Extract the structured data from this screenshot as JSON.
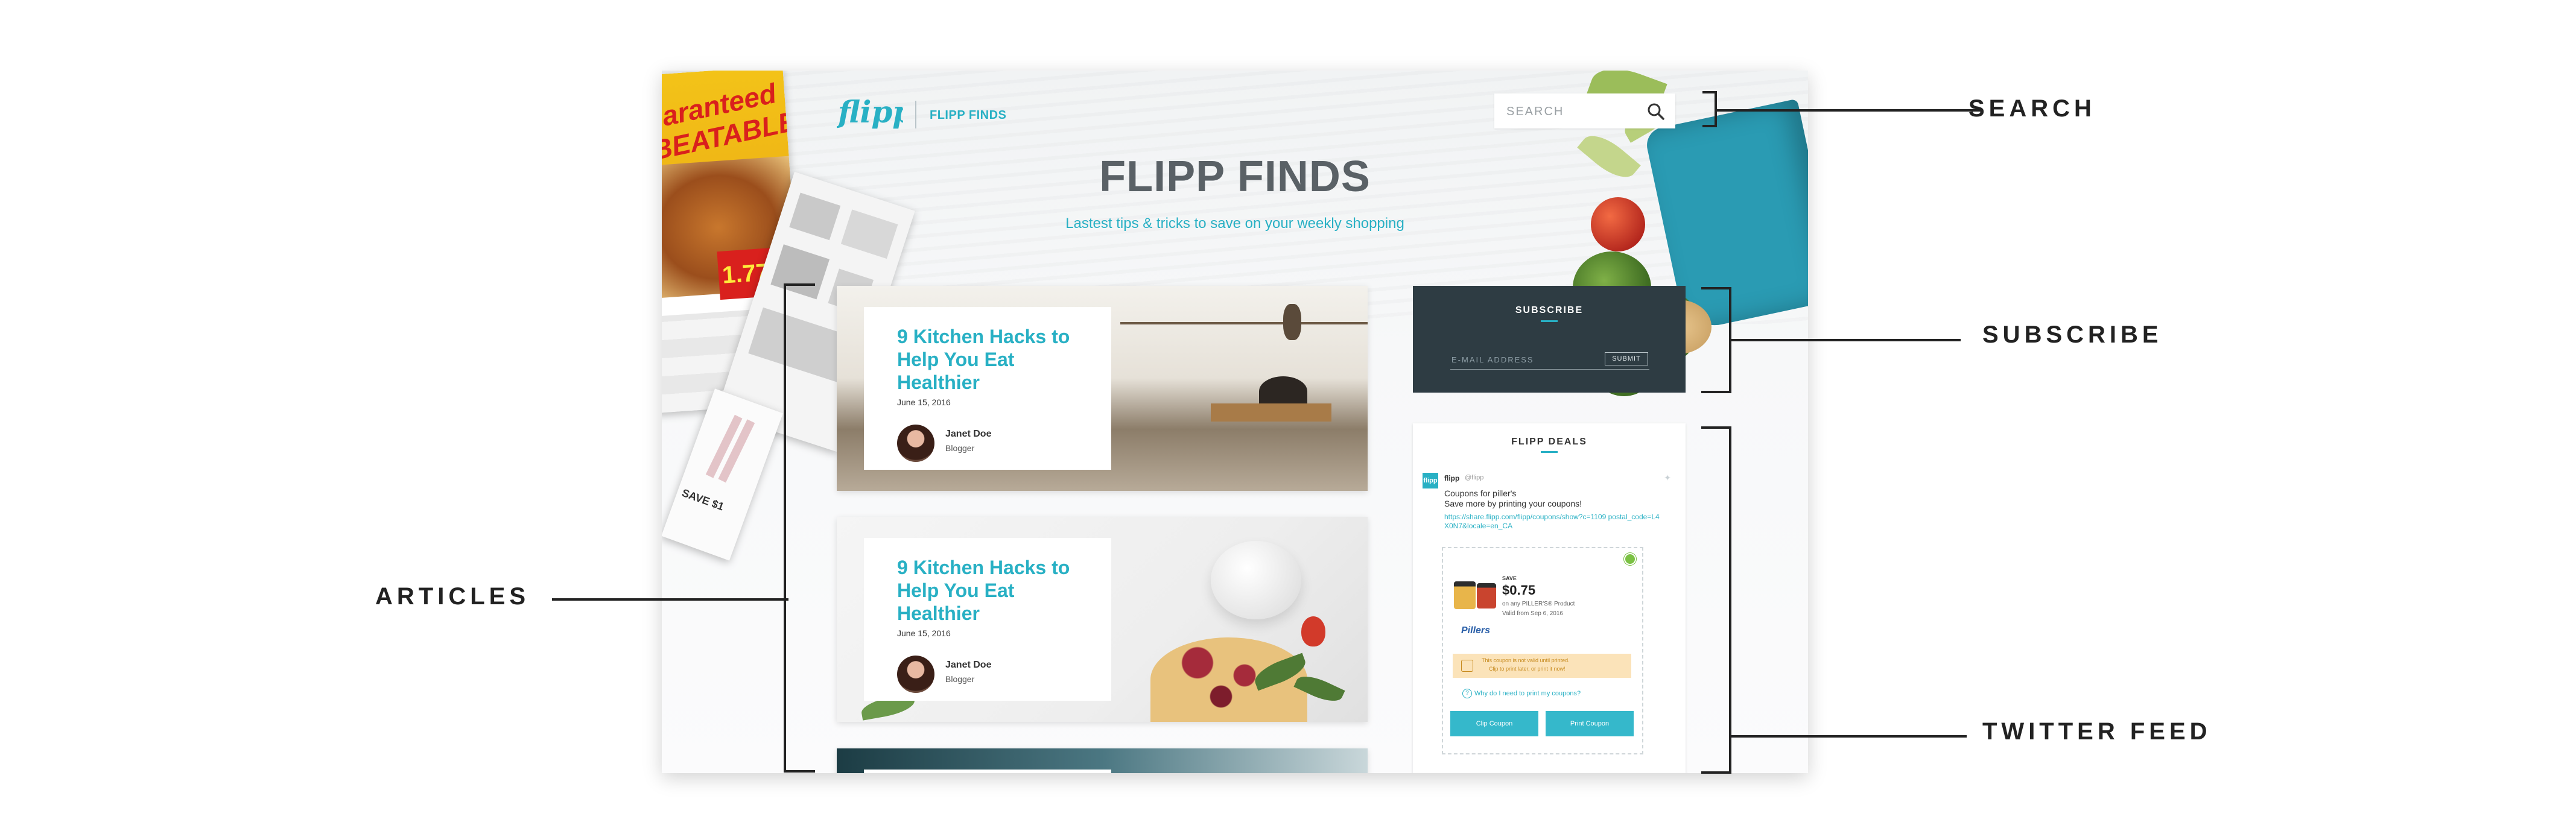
{
  "header": {
    "brand": "FLIPP FINDS",
    "search_placeholder": "SEARCH",
    "title": "FLIPP FINDS",
    "subtitle": "Lastest tips & tricks to save on your weekly shopping"
  },
  "flyer": {
    "headline_1": "uaranteed",
    "headline_2": "BEATABLE!",
    "price": "1.77",
    "save": "SAVE $1"
  },
  "articles": [
    {
      "title": "9 Kitchen Hacks to Help You Eat Healthier",
      "date": "June 15, 2016",
      "author": "Janet Doe",
      "role": "Blogger"
    },
    {
      "title": "9 Kitchen Hacks to Help You Eat Healthier",
      "date": "June 15, 2016",
      "author": "Janet Doe",
      "role": "Blogger"
    }
  ],
  "subscribe": {
    "title": "SUBSCRIBE",
    "email_placeholder": "E-MAIL ADDRESS",
    "submit_label": "SUBMIT"
  },
  "deals": {
    "title": "FLIPP DEALS",
    "tweet": {
      "avatar": "flipp",
      "name": "flipp",
      "handle": "@flipp",
      "text": "Coupons for piller's\nSave more by printing your coupons!",
      "link": "https://share.flipp.com/flipp/coupons/show?c=1109 postal_code=L4X0N7&locale=en_CA"
    },
    "coupon": {
      "save_label": "SAVE",
      "amount": "$0.75",
      "desc": "on any PILLER'S® Product",
      "valid": "Valid from Sep 6, 2016",
      "brand": "Pillers",
      "warning_1": "This coupon is not valid until printed.",
      "warning_2": "Clip to print later, or print it now!",
      "why_link": "Why do I need to print my coupons?",
      "clip_label": "Clip Coupon",
      "print_label": "Print Coupon"
    }
  },
  "callouts": {
    "search": "SEARCH",
    "subscribe": "SUBSCRIBE",
    "articles": "ARTICLES",
    "twitter_feed": "TWITTER FEED"
  },
  "colors": {
    "accent": "#28b0c4",
    "heading": "#5a6166",
    "subscribe_bg": "#2e3c43",
    "callout": "#222222"
  }
}
